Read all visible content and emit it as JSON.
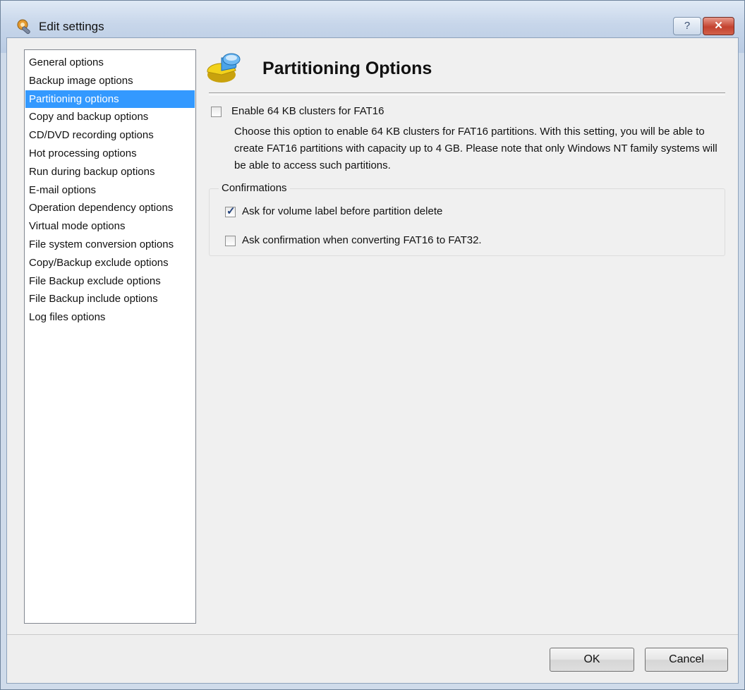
{
  "window": {
    "title": "Edit settings",
    "help_label": "?",
    "close_label": "✕"
  },
  "sidebar": {
    "items": [
      {
        "label": "General options",
        "selected": false
      },
      {
        "label": "Backup image options",
        "selected": false
      },
      {
        "label": "Partitioning options",
        "selected": true
      },
      {
        "label": "Copy and backup options",
        "selected": false
      },
      {
        "label": "CD/DVD recording options",
        "selected": false
      },
      {
        "label": "Hot processing options",
        "selected": false
      },
      {
        "label": "Run during backup options",
        "selected": false
      },
      {
        "label": "E-mail options",
        "selected": false
      },
      {
        "label": "Operation dependency options",
        "selected": false
      },
      {
        "label": "Virtual mode options",
        "selected": false
      },
      {
        "label": "File system conversion options",
        "selected": false
      },
      {
        "label": "Copy/Backup exclude options",
        "selected": false
      },
      {
        "label": "File Backup exclude options",
        "selected": false
      },
      {
        "label": "File Backup include options",
        "selected": false
      },
      {
        "label": "Log files options",
        "selected": false
      }
    ]
  },
  "page": {
    "title": "Partitioning Options",
    "icon": "partition-pie-icon"
  },
  "options": {
    "enable_64kb": {
      "label": "Enable 64 KB clusters for FAT16",
      "checked": false,
      "description": "Choose this option to enable 64 KB clusters for FAT16 partitions. With this setting, you will be able to create FAT16 partitions with capacity up to 4 GB. Please note that only Windows NT family systems will be able to access such partitions."
    },
    "confirmations": {
      "title": "Confirmations",
      "ask_volume_label": {
        "label": "Ask for volume label before partition delete",
        "checked": true
      },
      "ask_fat_conversion": {
        "label": "Ask confirmation when converting FAT16 to FAT32.",
        "checked": false
      }
    }
  },
  "buttons": {
    "ok": "OK",
    "cancel": "Cancel"
  },
  "colors": {
    "selection": "#3399ff",
    "dialog_background": "#f0f0f0",
    "frame": "#cfdbea"
  }
}
